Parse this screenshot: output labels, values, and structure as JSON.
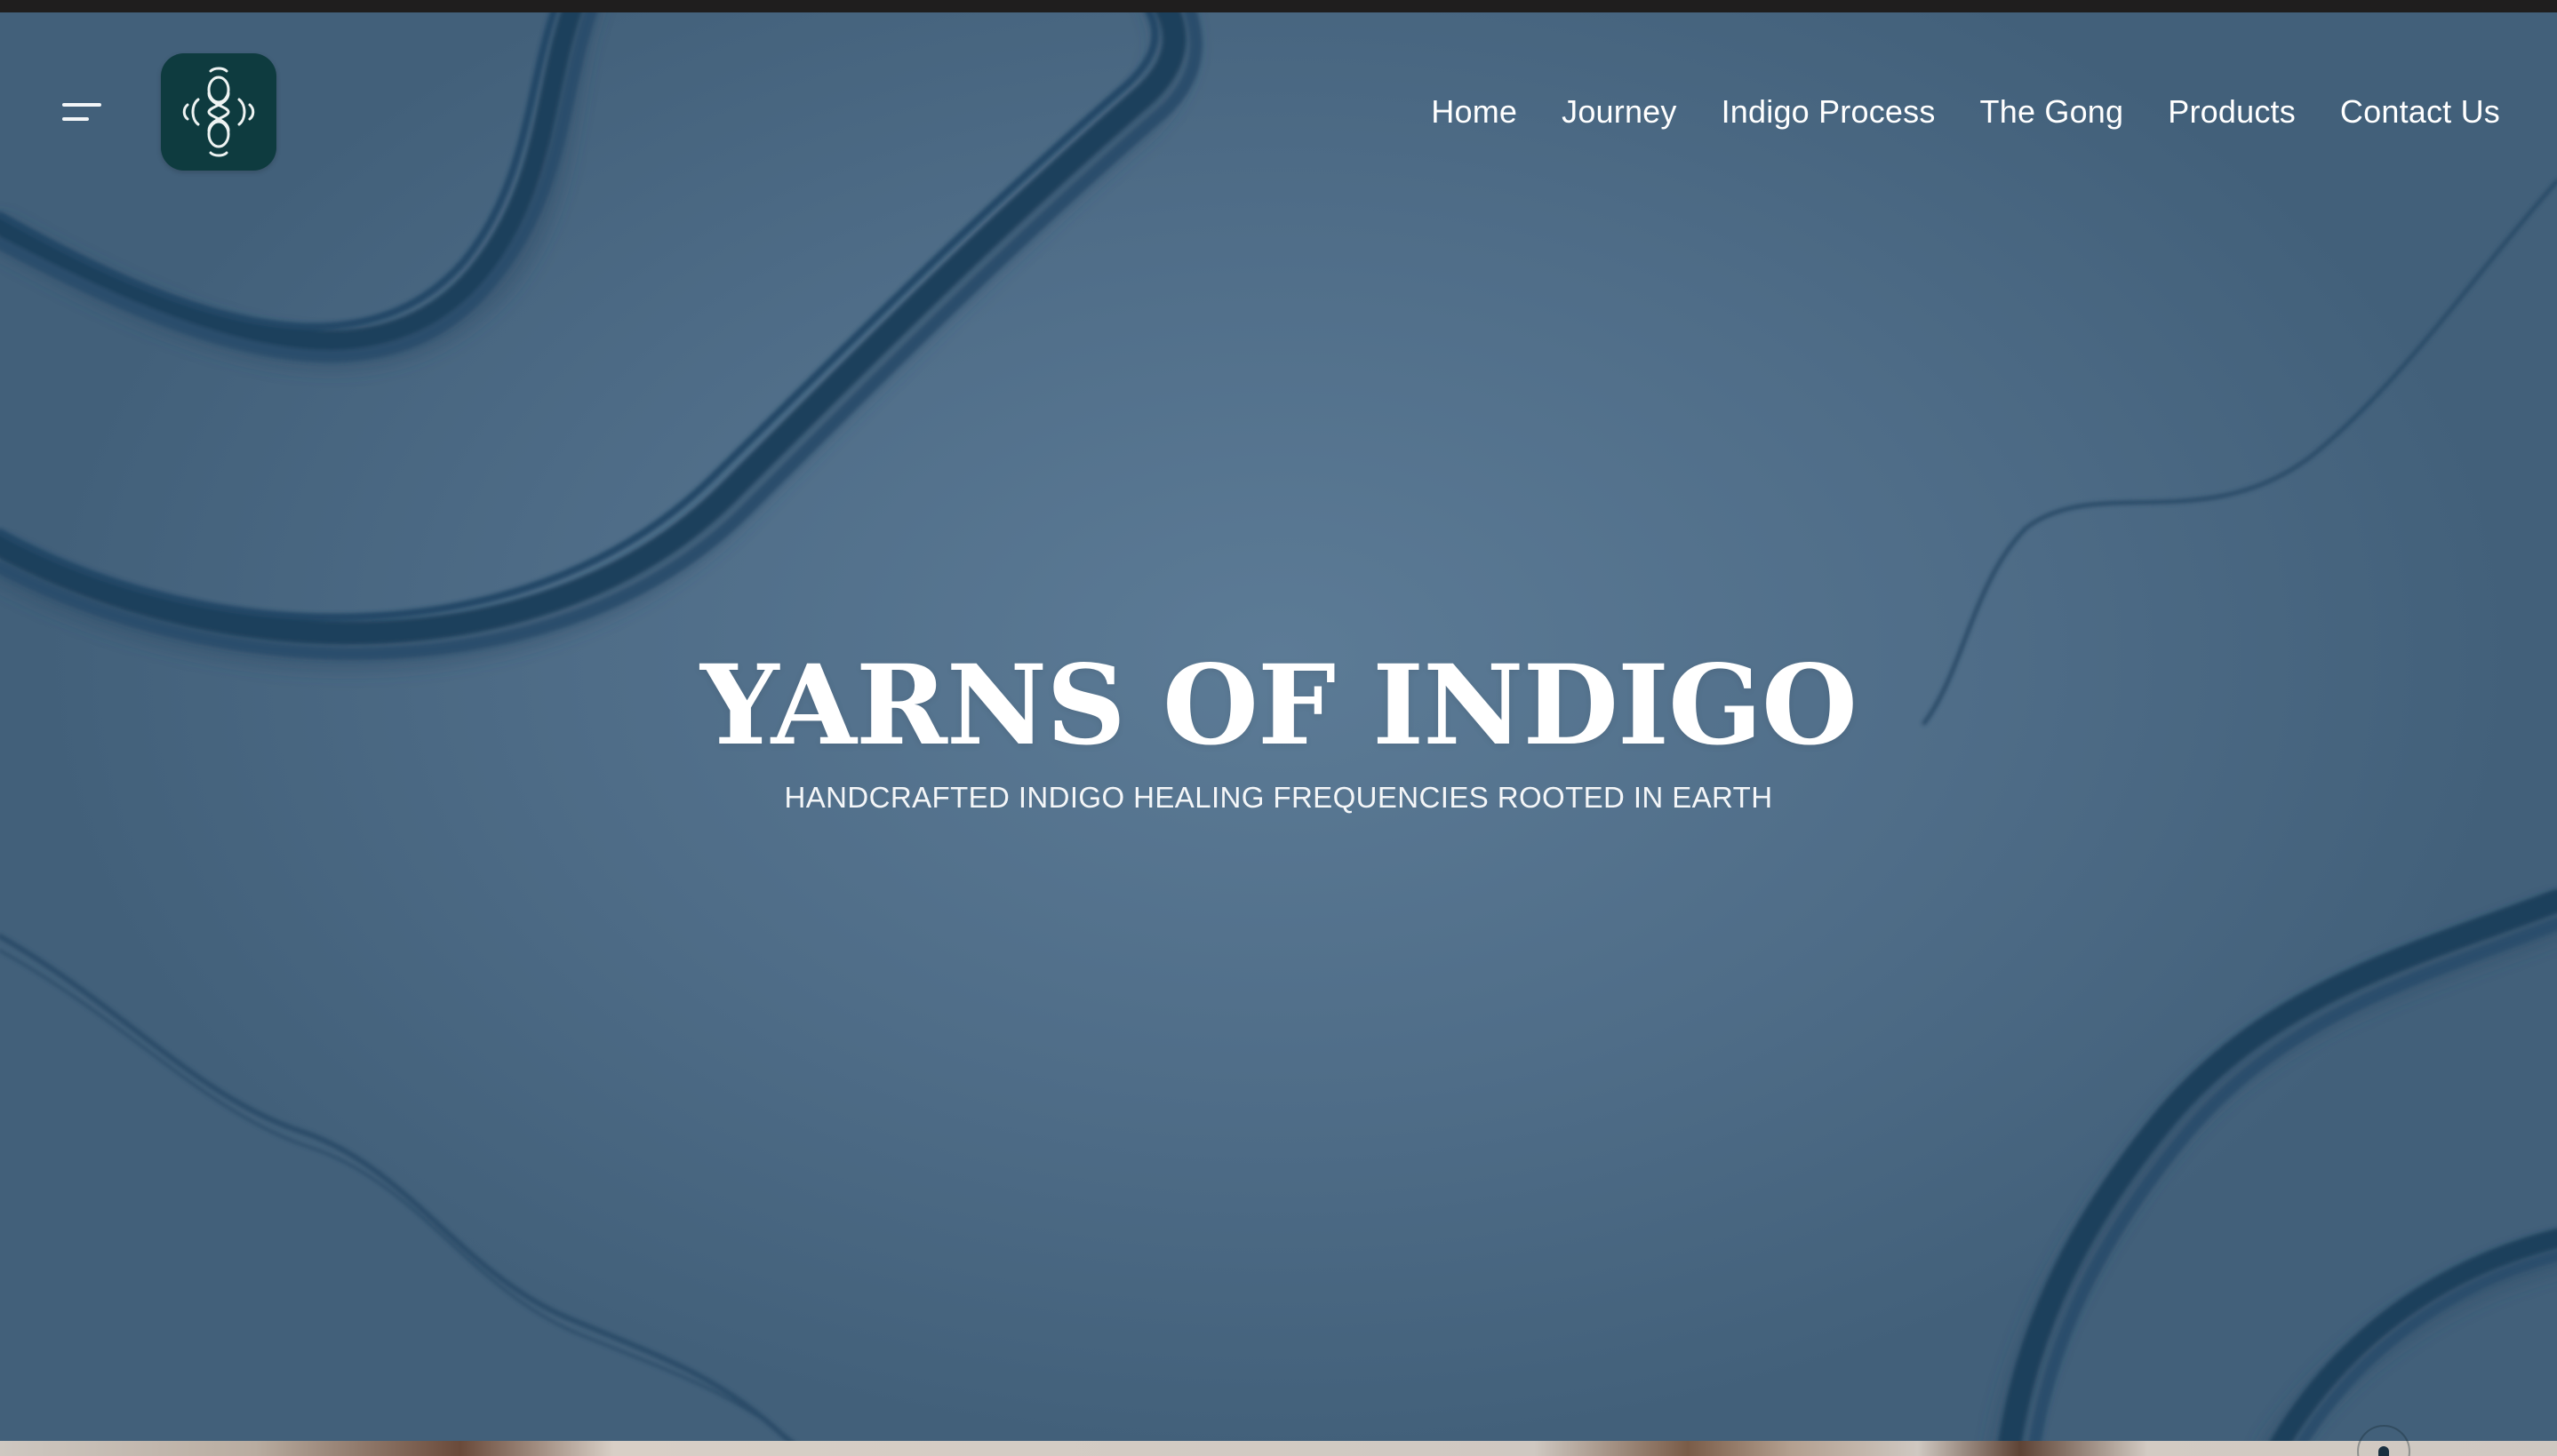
{
  "header": {
    "menu_icon": "hamburger-menu-icon",
    "logo_icon": "infinity-knot-logo-icon",
    "nav": [
      {
        "label": "Home"
      },
      {
        "label": "Journey"
      },
      {
        "label": "Indigo Process"
      },
      {
        "label": "The Gong"
      },
      {
        "label": "Products"
      },
      {
        "label": "Contact Us"
      }
    ]
  },
  "hero": {
    "title": "YARNS OF INDIGO",
    "subtitle": "HANDCRAFTED INDIGO HEALING FREQUENCIES ROOTED IN EARTH",
    "background_color": "#50708c",
    "yarn_color": "#1f3f5c"
  },
  "theme": {
    "logo_background": "#0e3b3f",
    "text_color": "#ffffff"
  }
}
